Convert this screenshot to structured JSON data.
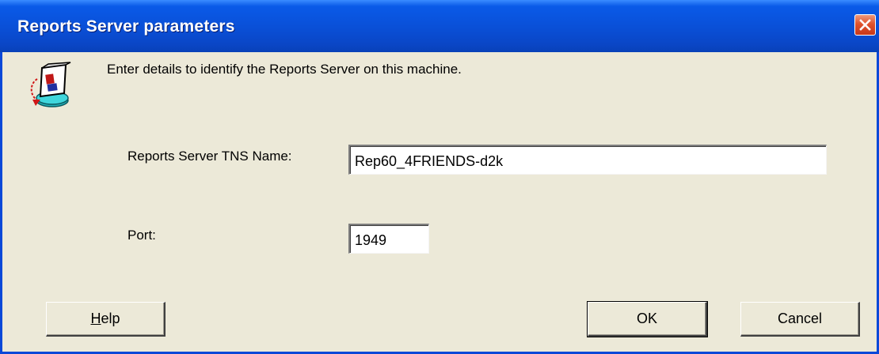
{
  "window": {
    "title": "Reports Server parameters",
    "close_icon": "close-icon"
  },
  "dialog": {
    "icon": "reports-server-icon",
    "prompt": "Enter details to identify the Reports Server on this machine."
  },
  "fields": {
    "tns_name": {
      "label": "Reports Server TNS Name:",
      "value": "Rep60_4FRIENDS-d2k"
    },
    "port": {
      "label": "Port:",
      "value": "1949"
    }
  },
  "buttons": {
    "help_mnemonic": "H",
    "help_rest": "elp",
    "ok": "OK",
    "cancel": "Cancel"
  },
  "colors": {
    "titlebar": "#0a4fd6",
    "face": "#ece9d8",
    "close": "#e0522c"
  }
}
